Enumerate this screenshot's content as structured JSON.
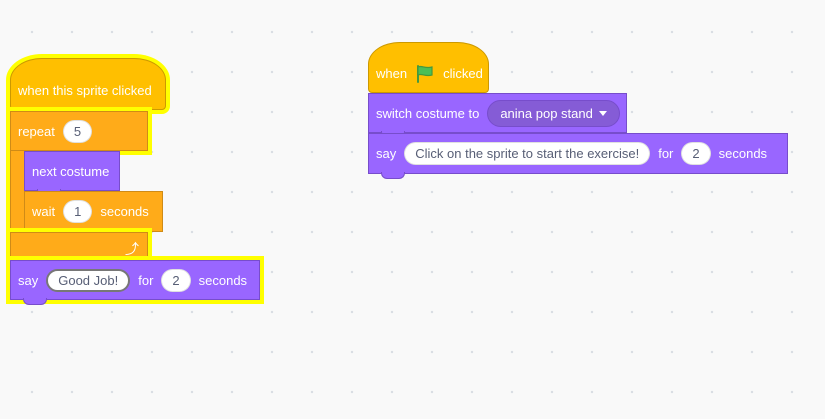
{
  "script_left": {
    "hat": {
      "label": "when this sprite clicked"
    },
    "repeat": {
      "label": "repeat",
      "count": "5"
    },
    "next_costume": {
      "label": "next costume"
    },
    "wait": {
      "label": "wait",
      "value": "1",
      "unit": "seconds"
    },
    "say": {
      "label": "say",
      "message": "Good Job!",
      "for_label": "for",
      "duration": "2",
      "unit": "seconds"
    }
  },
  "script_right": {
    "hat": {
      "label_before": "when",
      "icon": "green-flag-icon",
      "label_after": "clicked"
    },
    "switch_costume": {
      "label": "switch costume to",
      "costume": "anina pop stand"
    },
    "say": {
      "label": "say",
      "message": "Click on the sprite to start the exercise!",
      "for_label": "for",
      "duration": "2",
      "unit": "seconds"
    }
  },
  "colors": {
    "events": "#ffbf00",
    "control": "#ffab19",
    "looks": "#9966ff",
    "glow": "#ffff00",
    "flag": "#4cbf56"
  }
}
